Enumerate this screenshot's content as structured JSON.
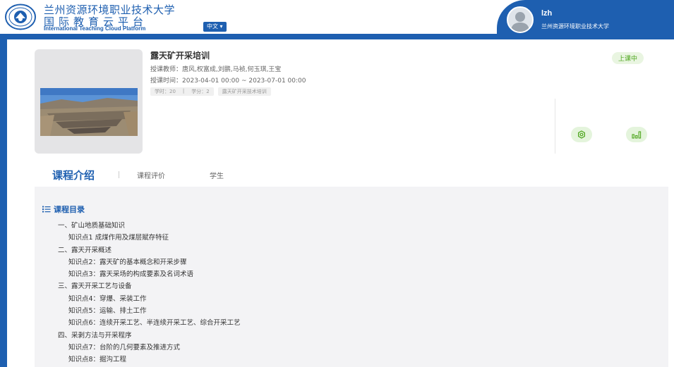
{
  "header": {
    "university_name": "兰州资源环境职业技术大学",
    "platform_name": "国际教育云平台",
    "platform_name_en": "International Teaching Cloud Platform",
    "language": "中文",
    "user": {
      "name": "lzh",
      "org": "兰州资源环境职业技术大学"
    }
  },
  "course": {
    "title": "露天矿开采培训",
    "teachers_label": "授课教师：",
    "teachers": "唐风,权富成,刘鹏,马祯,何玉琪,王宝",
    "time_label": "授课时间：",
    "time_range": "2023-04-01 00:00 ~ 2023-07-01 00:00",
    "hours": "学时：20",
    "separator": "|",
    "credits": "学分：2",
    "category_tag": "露天矿开采技术培训",
    "status": "上课中"
  },
  "tabs": {
    "intro": "课程介绍",
    "reviews": "课程评价",
    "students": "学生"
  },
  "catalog": {
    "title": "课程目录",
    "items": [
      {
        "text": "一、矿山地质基础知识",
        "level": "chapter"
      },
      {
        "text": "知识点1 成煤作用及煤层赋存特征",
        "level": "point"
      },
      {
        "text": "二、露天开采概述",
        "level": "chapter"
      },
      {
        "text": "知识点2：露天矿的基本概念和开采步骤",
        "level": "point"
      },
      {
        "text": "知识点3：露天采场的构成要素及名词术语",
        "level": "point"
      },
      {
        "text": "三、露天开采工艺与设备",
        "level": "chapter"
      },
      {
        "text": "知识点4：穿爆、采装工作",
        "level": "point"
      },
      {
        "text": "知识点5：运输、排土工作",
        "level": "point"
      },
      {
        "text": "知识点6：连续开采工艺、半连续开采工艺、综合开采工艺",
        "level": "point"
      },
      {
        "text": "四、采剥方法与开采程序",
        "level": "chapter"
      },
      {
        "text": "知识点7：台阶的几何要素及推进方式",
        "level": "point"
      },
      {
        "text": "知识点8：掘沟工程",
        "level": "point"
      }
    ]
  },
  "colors": {
    "brand_blue": "#1e5fb0",
    "status_green": "#4ea61e",
    "catalog_bg": "#f3f3f5"
  },
  "icons": [
    "university-seal-icon",
    "chevron-down-icon",
    "user-avatar-icon",
    "settings-icon",
    "bar-chart-icon",
    "list-icon"
  ]
}
